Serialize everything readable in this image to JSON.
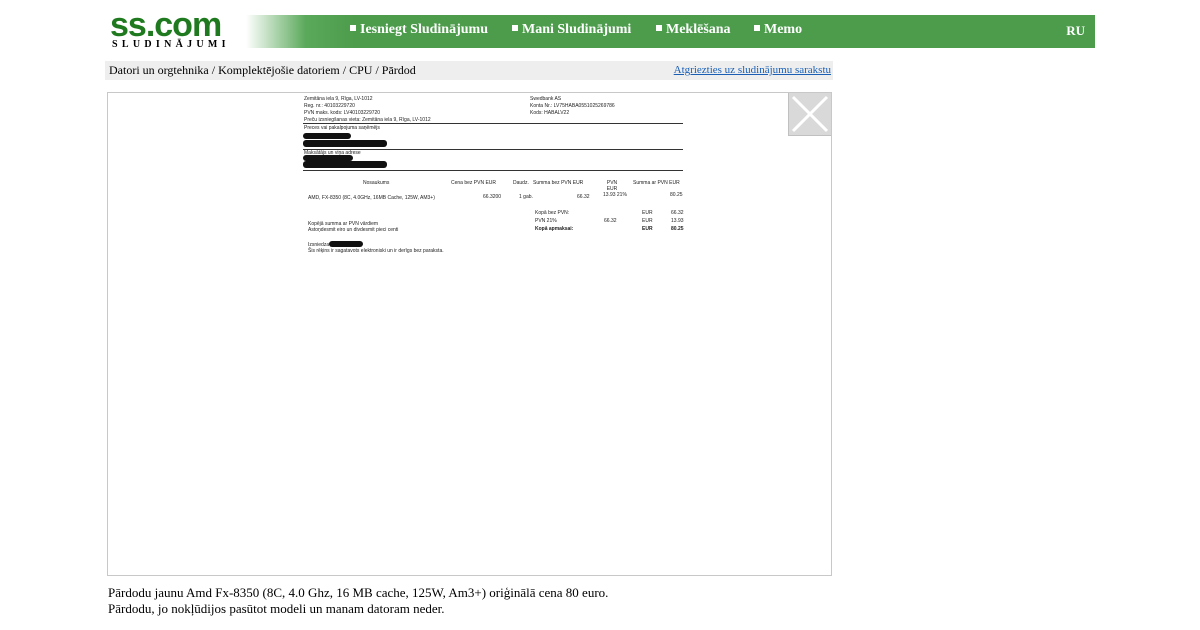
{
  "logo": {
    "main": "ss.com",
    "sub": "SLUDINĀJUMI"
  },
  "menu": {
    "items": [
      {
        "label": "Iesniegt Sludinājumu"
      },
      {
        "label": "Mani Sludinājumi"
      },
      {
        "label": "Meklēšana"
      },
      {
        "label": "Memo"
      }
    ],
    "lang": "RU"
  },
  "breadcrumb": {
    "items": [
      "Datori un orgtehnika",
      "Komplektējošie datoriem",
      "CPU",
      "Pārdod"
    ],
    "separator": " / ",
    "back_link": "Atgriezties uz sludinājumu sarakstu"
  },
  "viewer": {
    "close_icon": "close-icon",
    "invoice": {
      "seller_address": "Zemitāna iela 9, Rīga, LV-1012",
      "reg_nr": "Reg. nr.: 40103229720",
      "pvn_kods": "PVN maks. kods: LV40103229720",
      "issue_place": "Preču izsniegšanas vieta: Zemitāna iela 9, Rīga, LV-1012",
      "recipient_label": "Preces vai pakalpojuma saņēmējs",
      "payer_label": "Maksātājs un viņa adrese",
      "bank_name": "Swedbank AS",
      "bank_account": "Konta Nr.: LV75HABA0551025269786",
      "bank_code": "Kods: HABALV22",
      "col_name": "Nosaukums",
      "col_price": "Cena bez PVN EUR",
      "col_qty": "Daudz.",
      "col_sum": "Summa bez PVN EUR",
      "col_pvn": "PVN EUR",
      "col_total": "Summa ar PVN EUR",
      "item_name": "AMD, FX-8350 (8C, 4.0GHz, 16MB Cache, 125W, AM3+)",
      "item_price": "66.3200",
      "item_qty": "1 gab.",
      "item_sum": "66.32",
      "item_pvn": "13.93 21%",
      "item_total": "80.25",
      "subtotal_label": "Kopā bez PVN:",
      "subtotal_cur": "EUR",
      "subtotal_val": "66.32",
      "vat_label": "PVN 21%",
      "vat_base": "66.32",
      "vat_cur": "EUR",
      "vat_val": "13.93",
      "total_label": "Kopā apmaksai:",
      "total_cur": "EUR",
      "total_val": "80.25",
      "words_label": "Kopējā summa ar PVN vārdiem",
      "words_value": "Astoņdesmit eiro un divdesmit pieci centi",
      "issuer_label": "Izsniedza",
      "footer_note": "Šis rēķins ir sagatavots elektroniski un ir derīgs bez paraksta."
    }
  },
  "description": {
    "line1": "Pārdodu jaunu Amd Fx-8350 (8C, 4.0 Ghz, 16 MB cache, 125W, Am3+) oriģinālā cena 80 euro.",
    "line2": "Pārdodu, jo nokļūdijos pasūtot modeli un manam datoram neder."
  },
  "colors": {
    "brand_green": "#4c9c4c",
    "logo_green": "#1f7a1f",
    "link_blue": "#1a5fb4",
    "crumb_bg": "#eeeeee"
  }
}
